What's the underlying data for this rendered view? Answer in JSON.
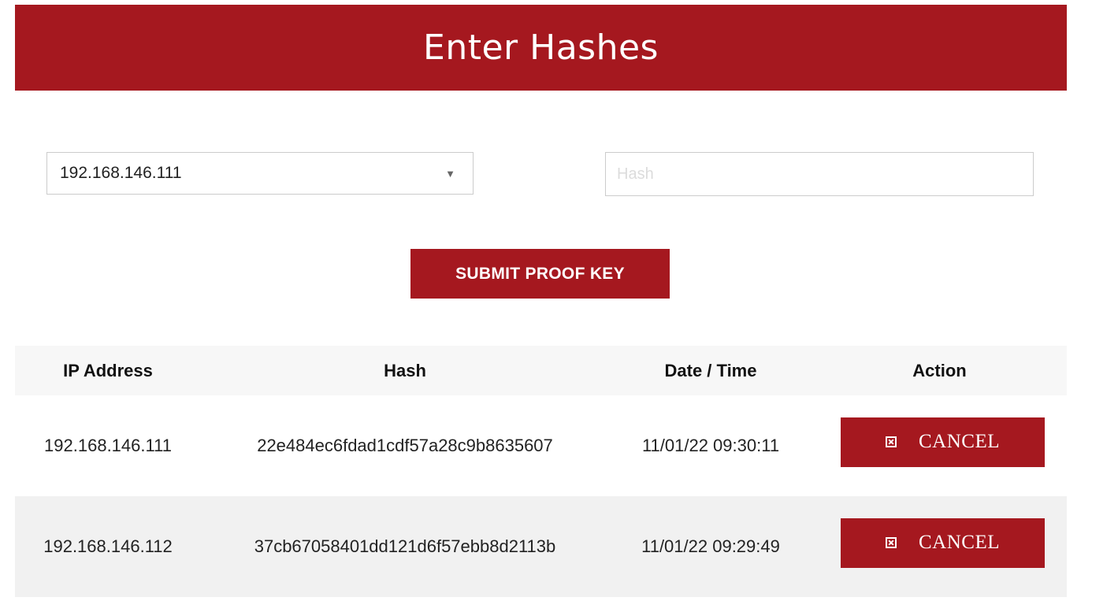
{
  "header": {
    "title": "Enter Hashes"
  },
  "form": {
    "ip_select_value": "192.168.146.111",
    "hash_placeholder": "Hash",
    "hash_value": "",
    "submit_label": "SUBMIT PROOF KEY"
  },
  "table": {
    "columns": [
      "IP Address",
      "Hash",
      "Date / Time",
      "Action"
    ],
    "rows": [
      {
        "ip": "192.168.146.111",
        "hash": "22e484ec6fdad1cdf57a28c9b8635607",
        "datetime": "11/01/22 09:30:11",
        "action_label": "CANCEL"
      },
      {
        "ip": "192.168.146.112",
        "hash": "37cb67058401dd121d6f57ebb8d2113b",
        "datetime": "11/01/22 09:29:49",
        "action_label": "CANCEL"
      }
    ]
  },
  "colors": {
    "accent": "#a5181f"
  },
  "icons": {
    "select_arrow": "chevron-down-icon",
    "cancel": "close-box-icon"
  }
}
